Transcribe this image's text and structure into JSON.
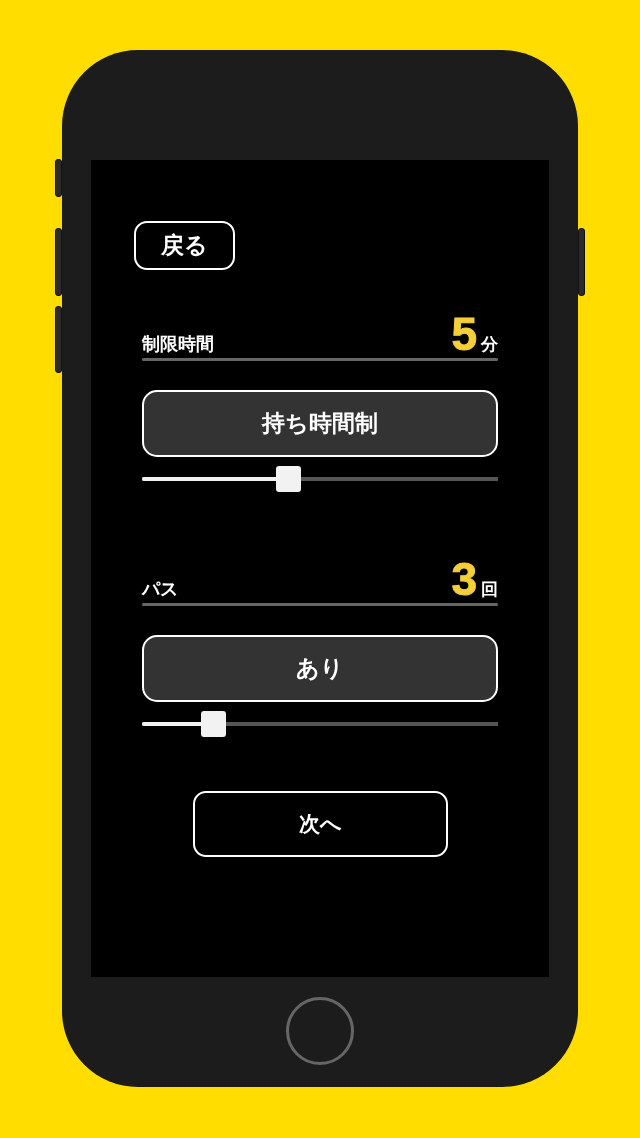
{
  "back_button": {
    "label": "戻る"
  },
  "settings": [
    {
      "label": "制限時間",
      "value": "5",
      "unit": "分",
      "mode": "持ち時間制",
      "level": 0.41
    },
    {
      "label": "パス",
      "value": "3",
      "unit": "回",
      "mode": "あり",
      "level": 0.2
    }
  ],
  "next_button": {
    "label": "次へ"
  }
}
